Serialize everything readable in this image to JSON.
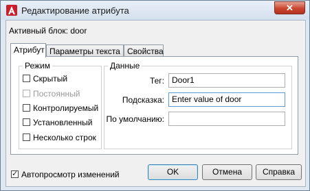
{
  "window": {
    "title": "Редактирование атрибута"
  },
  "active_block_label": "Активный блок: door",
  "tabs": [
    {
      "label": "Атрибут",
      "active": true
    },
    {
      "label": "Параметры текста",
      "active": false
    },
    {
      "label": "Свойства",
      "active": false
    }
  ],
  "mode": {
    "title": "Режим",
    "options": [
      {
        "label": "Скрытый",
        "checked": false,
        "enabled": true
      },
      {
        "label": "Постоянный",
        "checked": false,
        "enabled": false
      },
      {
        "label": "Контролируемый",
        "checked": false,
        "enabled": true
      },
      {
        "label": "Установленный",
        "checked": false,
        "enabled": true
      },
      {
        "label": "Несколько строк",
        "checked": false,
        "enabled": true
      }
    ]
  },
  "data_group": {
    "title": "Данные",
    "tag": {
      "label": "Тег:",
      "value": "Door1"
    },
    "prompt": {
      "label": "Подсказка:",
      "value": "Enter value of door"
    },
    "default": {
      "label": "По умолчанию:",
      "value": ""
    }
  },
  "preview": {
    "label": "Автопросмотр изменений",
    "checked": true
  },
  "buttons": {
    "ok": "OK",
    "cancel": "Отмена",
    "help": "Справка"
  },
  "icons": {
    "app": "autocad-icon",
    "close": "close-icon"
  },
  "colors": {
    "close_red": "#c9452f",
    "titlebar": "#dfe7f1",
    "focus_border": "#5b9bd5"
  }
}
